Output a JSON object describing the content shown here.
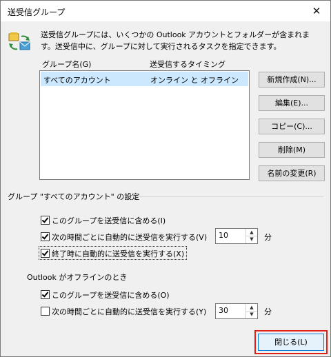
{
  "window": {
    "title": "送受信グループ",
    "close_glyph": "✕"
  },
  "description": "送受信グループには、いくつかの Outlook アカウントとフォルダーが含まれます。送受信中に、グループに対して実行されるタスクを指定できます。",
  "list": {
    "col_group": "グループ名(G)",
    "col_timing": "送受信するタイミング",
    "rows": [
      {
        "name": "すべてのアカウント",
        "timing": "オンライン と オフライン"
      }
    ]
  },
  "buttons": {
    "new": "新規作成(N)...",
    "edit": "編集(E)...",
    "copy": "コピー(C)...",
    "delete": "削除(M)",
    "rename": "名前の変更(R)"
  },
  "settings": {
    "heading": "グループ \"すべてのアカウント\" の設定",
    "online": {
      "include": {
        "label": "このグループを送受信に含める(I)",
        "checked": true
      },
      "auto": {
        "label": "次の時間ごとに自動的に送受信を実行する(V)",
        "checked": true,
        "value": "10",
        "unit": "分"
      },
      "on_exit": {
        "label": "終了時に自動的に送受信を実行する(X)",
        "checked": true
      }
    },
    "offline_heading": "Outlook がオフラインのとき",
    "offline": {
      "include": {
        "label": "このグループを送受信に含める(O)",
        "checked": true
      },
      "auto": {
        "label": "次の時間ごとに自動的に送受信を実行する(Y)",
        "checked": false,
        "value": "30",
        "unit": "分"
      }
    }
  },
  "close_button": "閉じる(L)",
  "icons": {
    "app": "send-receive-icon",
    "spin_up": "▲",
    "spin_down": "▼"
  }
}
